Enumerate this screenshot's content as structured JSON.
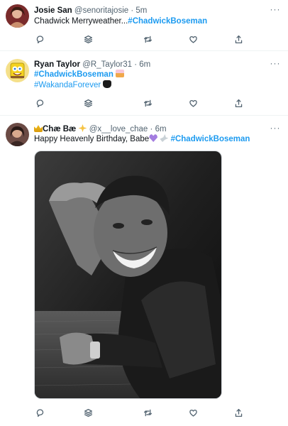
{
  "tweets": [
    {
      "name": "Josie San",
      "handle": "@senoritajosie",
      "sep": "·",
      "time": "5m",
      "text": "Chadwick Merryweather...",
      "hashtag": "#ChadwickBoseman"
    },
    {
      "name": "Ryan Taylor",
      "handle": "@R_Taylor31",
      "sep": "·",
      "time": "6m",
      "hashtag1": "#ChadwickBoseman",
      "hashtag2": "#WakandaForever"
    },
    {
      "name": "Chæ Bæ",
      "handle": "@x__love_chae",
      "sep": "·",
      "time": "6m",
      "text": "Happy Heavenly Birthday, Babe",
      "hashtag": "#ChadwickBoseman"
    }
  ],
  "more_label": "···",
  "icons": [
    "reply-icon",
    "stack-icon",
    "retweet-icon",
    "like-icon",
    "share-icon"
  ],
  "colors": {
    "link": "#1d9bf0",
    "muted": "#536471",
    "text": "#0f1419"
  }
}
